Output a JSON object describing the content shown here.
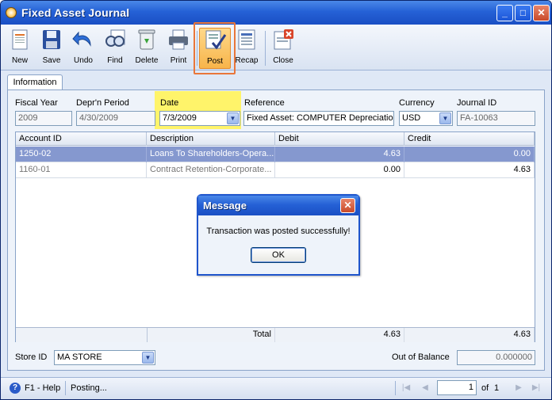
{
  "window": {
    "title": "Fixed Asset Journal",
    "minimize": "_",
    "maximize": "□",
    "close": "✕"
  },
  "toolbar": {
    "new": "New",
    "save": "Save",
    "undo": "Undo",
    "find": "Find",
    "delete": "Delete",
    "print": "Print",
    "post": "Post",
    "recap": "Recap",
    "close": "Close"
  },
  "tabs": {
    "information": "Information"
  },
  "form": {
    "fiscal_year_label": "Fiscal Year",
    "fiscal_year": "2009",
    "deprn_period_label": "Depr'n Period",
    "deprn_period": "4/30/2009",
    "date_label": "Date",
    "date": "7/3/2009",
    "reference_label": "Reference",
    "reference": "Fixed Asset: COMPUTER Depreciation",
    "currency_label": "Currency",
    "currency": "USD",
    "journal_id_label": "Journal ID",
    "journal_id": "FA-10063"
  },
  "grid": {
    "columns": [
      "Account ID",
      "Description",
      "Debit",
      "Credit"
    ],
    "rows": [
      {
        "account_id": "1250-02",
        "description": "Loans To Shareholders-Opera...",
        "debit": "4.63",
        "credit": "0.00"
      },
      {
        "account_id": "1160-01",
        "description": "Contract Retention-Corporate...",
        "debit": "0.00",
        "credit": "4.63"
      }
    ],
    "total_label": "Total",
    "total_debit": "4.63",
    "total_credit": "4.63"
  },
  "footer": {
    "store_id_label": "Store ID",
    "store_id": "MA STORE",
    "out_of_balance_label": "Out of Balance",
    "out_of_balance": "0.000000"
  },
  "dialog": {
    "title": "Message",
    "message": "Transaction was posted successfully!",
    "ok": "OK",
    "close": "✕"
  },
  "status": {
    "help": "F1 - Help",
    "text": "Posting...",
    "page": "1",
    "of_label": "of",
    "total_pages": "1"
  },
  "colors": {
    "title_blue": "#2561d6",
    "date_highlight": "#fff46a",
    "post_highlight": "#e9763a",
    "selected_row": "#8598cf"
  },
  "icons": [
    "new-icon",
    "save-icon",
    "undo-icon",
    "find-icon",
    "delete-icon",
    "print-icon",
    "post-icon",
    "recap-icon",
    "close-icon",
    "help-icon",
    "chevron-down-icon"
  ]
}
